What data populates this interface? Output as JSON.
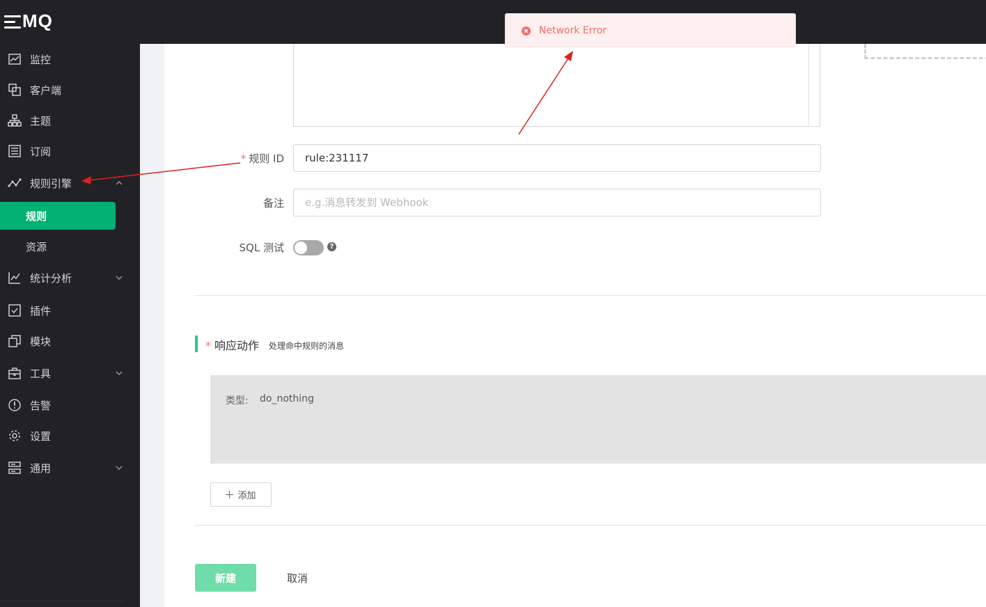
{
  "brand": {
    "logo_text": "MQ"
  },
  "sidebar": {
    "items": [
      {
        "label": "监控",
        "icon": "monitor-chart-icon"
      },
      {
        "label": "客户端",
        "icon": "clients-icon"
      },
      {
        "label": "主题",
        "icon": "topics-tree-icon"
      },
      {
        "label": "订阅",
        "icon": "subscriptions-list-icon"
      },
      {
        "label": "规则引擎",
        "icon": "rule-engine-icon",
        "expanded": true
      },
      {
        "label": "统计分析",
        "icon": "analytics-icon"
      },
      {
        "label": "插件",
        "icon": "plugins-checkbox-icon"
      },
      {
        "label": "模块",
        "icon": "modules-icon"
      },
      {
        "label": "工具",
        "icon": "tools-toolbox-icon"
      },
      {
        "label": "告警",
        "icon": "alarm-icon"
      },
      {
        "label": "设置",
        "icon": "settings-gear-icon"
      },
      {
        "label": "通用",
        "icon": "general-icon"
      }
    ],
    "sub_items": [
      {
        "label": "规则",
        "active": true
      },
      {
        "label": "资源",
        "active": false
      }
    ]
  },
  "form": {
    "rule_id": {
      "label": "规则 ID",
      "value": "rule:231117"
    },
    "note": {
      "label": "备注",
      "placeholder": "e.g.消息转发到 Webhook"
    },
    "sql_test": {
      "label": "SQL 测试",
      "enabled": false,
      "help": "?"
    }
  },
  "actions": {
    "title": "响应动作",
    "subtitle": "处理命中规则的消息",
    "items": [
      {
        "type_label": "类型:",
        "type_value": "do_nothing"
      }
    ],
    "add_label": "添加",
    "add_icon": "plus-icon"
  },
  "buttons": {
    "create": "新建",
    "cancel": "取消"
  },
  "toast": {
    "message": "Network Error",
    "icon": "error-circle-icon"
  },
  "colors": {
    "sidebar_bg": "#222226",
    "accent": "#00b173",
    "create_button": "#6fdcaa",
    "error": "#f56c6c",
    "annotation_arrow": "#e02020"
  }
}
